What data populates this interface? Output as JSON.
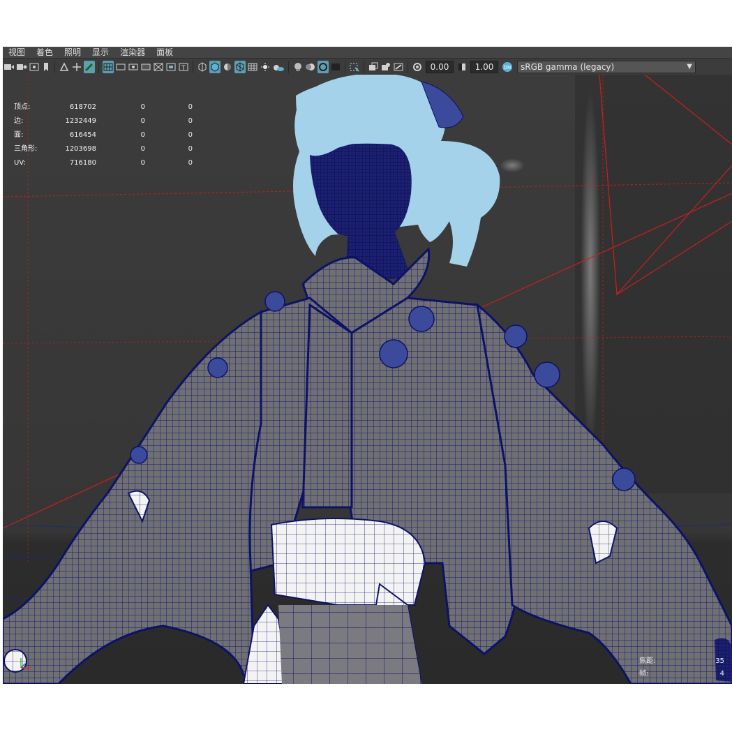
{
  "menubar": {
    "items": [
      "视图",
      "着色",
      "照明",
      "显示",
      "渲染器",
      "面板"
    ]
  },
  "toolbar": {
    "exposure_value": "0.00",
    "gamma_value": "1.00",
    "colorspace_label": "sRGB gamma (legacy)",
    "icons": [
      "camera-icon",
      "bookmark-icon",
      "grid-icon",
      "wireframe-icon",
      "shaded-icon",
      "texture-icon",
      "light-icon",
      "shadow-icon",
      "isolate-icon",
      "xray-icon",
      "exposure-icon",
      "gamma-icon",
      "color-mgmt-icon"
    ]
  },
  "hud": {
    "rows": [
      {
        "label": "顶点:",
        "v1": "618702",
        "v2": "0",
        "v3": "0"
      },
      {
        "label": "边:",
        "v1": "1232449",
        "v2": "0",
        "v3": "0"
      },
      {
        "label": "面:",
        "v1": "616454",
        "v2": "0",
        "v3": "0"
      },
      {
        "label": "三角形:",
        "v1": "1203698",
        "v2": "0",
        "v3": "0"
      },
      {
        "label": "UV:",
        "v1": "716180",
        "v2": "0",
        "v3": "0"
      }
    ],
    "bottom_right": [
      {
        "label": "焦距:",
        "value": "35"
      },
      {
        "label": "帧:",
        "value": "4"
      }
    ]
  },
  "colors": {
    "viewport_bg": "#3b3b3b",
    "mesh_fill": "#6f6f74",
    "wire": "#0d1266",
    "hair": "#a4d2ea",
    "sash": "#f3f3f3",
    "camera_lines": "#cc1e1e"
  }
}
